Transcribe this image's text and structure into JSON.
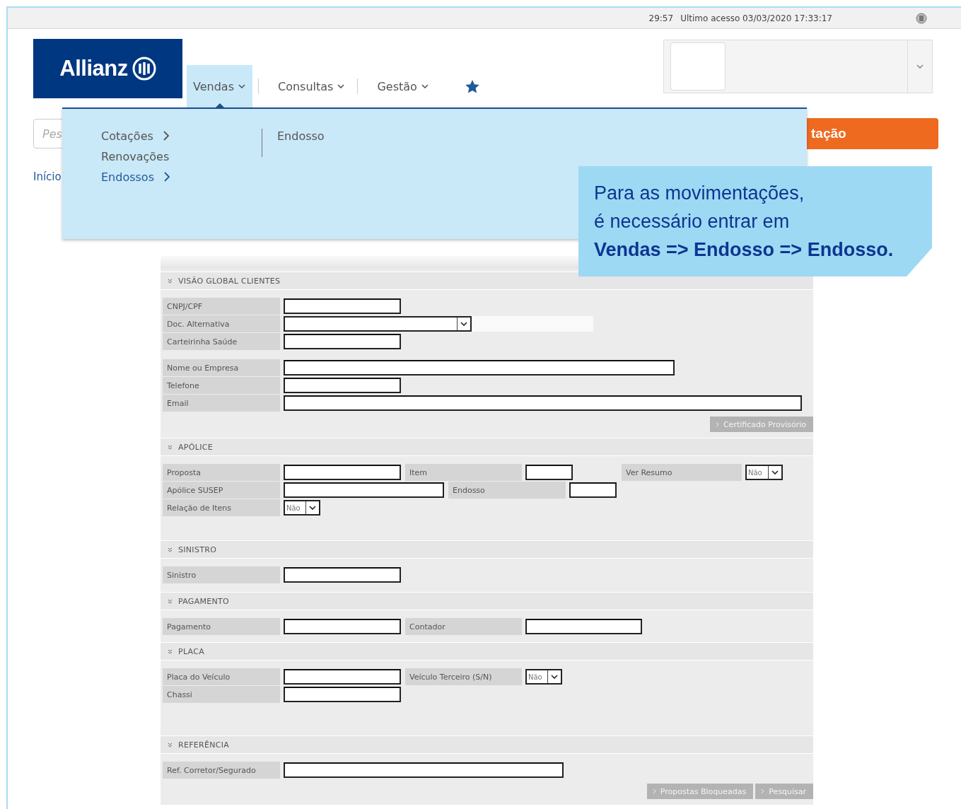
{
  "top_bar": {
    "session_timer": "29:57",
    "last_access": "Ultimo acesso 03/03/2020 17:33:17"
  },
  "logo": "Allianz",
  "nav": [
    {
      "label": "Vendas",
      "selected": true
    },
    {
      "label": "Consultas",
      "selected": false
    },
    {
      "label": "Gestão",
      "selected": false
    }
  ],
  "search": {
    "placeholder": "Pes"
  },
  "action_button": "tação",
  "breadcrumb": "Início",
  "menu": {
    "items": [
      {
        "label": "Cotações",
        "has_submenu": true,
        "selected": false
      },
      {
        "label": "Renovações",
        "has_submenu": false,
        "selected": false
      },
      {
        "label": "Endossos",
        "has_submenu": true,
        "selected": true
      }
    ],
    "submenu": [
      "Endosso"
    ]
  },
  "callout": {
    "text": "Para as movimentações,\né necessário entrar em",
    "emphasis": "Vendas => Endosso => Endosso."
  },
  "form": {
    "sections": [
      {
        "title": "VISÃO GLOBAL CLIENTES",
        "rows": [
          [
            {
              "label": "CNPJ/CPF",
              "kind": "text"
            }
          ],
          [
            {
              "label": "Doc. Alternativa",
              "kind": "select"
            }
          ],
          [
            {
              "label": "Carteirinha Saúde",
              "kind": "text"
            }
          ],
          [
            {
              "label": "Nome ou Empresa",
              "kind": "text"
            }
          ],
          [
            {
              "label": "Telefone",
              "kind": "text"
            }
          ],
          [
            {
              "label": "Email",
              "kind": "text"
            }
          ]
        ],
        "buttons": [
          "Certificado Provisório"
        ]
      },
      {
        "title": "APÓLICE",
        "rows": [
          [
            {
              "label": "Proposta",
              "kind": "text"
            },
            {
              "label": "Item",
              "kind": "text"
            },
            {
              "label": "Ver Resumo",
              "kind": "select",
              "value": "Não"
            }
          ],
          [
            {
              "label": "Apólice SUSEP",
              "kind": "text"
            },
            {
              "label": "Endosso",
              "kind": "text"
            }
          ],
          [
            {
              "label": "Relação de Itens",
              "kind": "select",
              "value": "Não"
            }
          ]
        ]
      },
      {
        "title": "SINISTRO",
        "rows": [
          [
            {
              "label": "Sinistro",
              "kind": "text"
            }
          ]
        ]
      },
      {
        "title": "PAGAMENTO",
        "rows": [
          [
            {
              "label": "Pagamento",
              "kind": "text"
            },
            {
              "label": "Contador",
              "kind": "text"
            }
          ]
        ]
      },
      {
        "title": "PLACA",
        "rows": [
          [
            {
              "label": "Placa do Veículo",
              "kind": "text"
            },
            {
              "label": "Veículo Terceiro (S/N)",
              "kind": "select",
              "value": "Não"
            }
          ],
          [
            {
              "label": "Chassi",
              "kind": "text"
            }
          ]
        ]
      },
      {
        "title": "REFERÊNCIA",
        "rows": [
          [
            {
              "label": "Ref. Corretor/Segurado",
              "kind": "text"
            }
          ]
        ],
        "buttons": [
          "Propostas Bloqueadas",
          "Pesquisar"
        ]
      }
    ]
  }
}
